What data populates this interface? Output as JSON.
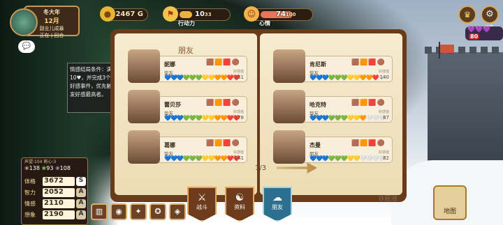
{
  "season": {
    "season": "冬大年",
    "month": "12月",
    "line3": "副业儿成暴",
    "line4": "正在 | 回合"
  },
  "chat_icon": "💬",
  "resources": {
    "gold": {
      "value": "2467",
      "unit": "G"
    },
    "action": {
      "label": "行动力",
      "value": "10",
      "max": "33",
      "fill": 0.3
    },
    "mood": {
      "label": "心情",
      "value": "74",
      "max": "100",
      "fill": 0.74
    }
  },
  "top_right": {
    "hearts": "💜💜💜",
    "count": "80",
    "label": "好感"
  },
  "tooltip": "情感结局条件：满10♥，并完成3个好感事件，优先触发好感最高者。",
  "book": {
    "title": "朋友",
    "pager": "1/3",
    "left": [
      {
        "name": "妮娜",
        "rel": "挚友",
        "chips": "🟫🟧🟥🟤",
        "hearts": "💙💙💙💚💚💚💛💛🧡🧡❤️❤️",
        "score_label": "好感值",
        "score": "251"
      },
      {
        "name": "蕾贝莎",
        "rel": "挚友",
        "chips": "🟫🟧🟥🟤",
        "hearts": "💙💙💙💚💚💚💛💛🧡🧡❤️❤️",
        "score_label": "好感值",
        "score": "178"
      },
      {
        "name": "葛娜",
        "rel": "挚友",
        "chips": "🟫🟧🟥🟤",
        "hearts": "💙💙💙💚💚💚💛💛🧡🧡❤️❤️",
        "score_label": "好感值",
        "score": "141"
      }
    ],
    "right": [
      {
        "name": "肯尼斯",
        "rel": "挚友",
        "chips": "🟫🟧🟥🟤",
        "hearts": "💙💙💙💚💚💚💛💛🧡🧡❤️🤍",
        "score_label": "好感值",
        "score": "140"
      },
      {
        "name": "哈克特",
        "rel": "挚友",
        "chips": "🟫🟧🟥🟤",
        "hearts": "💙💙💙💚💚💚💛💛🧡🤍🤍🤍",
        "score_label": "好感值",
        "score": "87"
      },
      {
        "name": "杰曼",
        "rel": "朋友",
        "chips": "🟫🟧🟥🟤",
        "hearts": "💙💙💙💚💚💚💛💛🤍🤍🤍🤍",
        "score_label": "好感值",
        "score": "82"
      }
    ]
  },
  "stats": {
    "header": "声望:104  割心:3",
    "affinity": [
      "138",
      "93",
      "108"
    ],
    "rows": [
      {
        "label": "体格",
        "value": "3672",
        "grade": "S"
      },
      {
        "label": "智力",
        "value": "2052",
        "grade": "A"
      },
      {
        "label": "情感",
        "value": "2110",
        "grade": "A"
      },
      {
        "label": "想象",
        "value": "2190",
        "grade": "A"
      }
    ]
  },
  "tabs": [
    {
      "label": "战斗",
      "icon": "⚔"
    },
    {
      "label": "资料",
      "icon": "☯"
    },
    {
      "label": "朋友",
      "icon": "☁"
    }
  ],
  "wish": "许愿池",
  "map": "地图"
}
